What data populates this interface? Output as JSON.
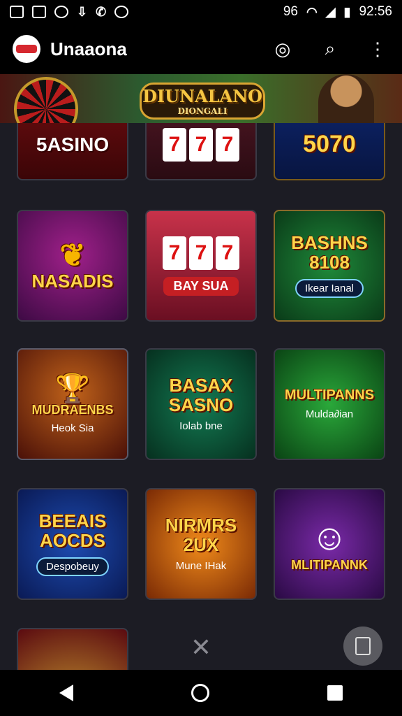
{
  "status": {
    "time": "92:56",
    "network_label": "96",
    "left_icons": [
      "gallery-icon",
      "image-icon",
      "sync-icon",
      "download-icon",
      "call-icon",
      "circle-icon"
    ],
    "right_icons": [
      "wifi-icon",
      "signal-icon",
      "battery-icon"
    ]
  },
  "appbar": {
    "title": "Unaaona",
    "actions": [
      "qr-icon",
      "search-icon",
      "more-vert-icon"
    ]
  },
  "banner": {
    "title": "DIUNALANO",
    "subtitle": "DIONGALI"
  },
  "tiles": [
    {
      "name": "tile-5asino",
      "title": "5ASINO",
      "caption": ""
    },
    {
      "name": "tile-slots-reels",
      "title": "",
      "caption": ""
    },
    {
      "name": "tile-5070",
      "title": "5070",
      "caption": ""
    },
    {
      "name": "tile-nasadis",
      "title": "NASADIS",
      "caption": ""
    },
    {
      "name": "tile-bay-sua",
      "title": "",
      "caption": "BAY SUA"
    },
    {
      "name": "tile-basans-8108",
      "title": "BASHNS 8108",
      "caption": "Ikear Ianal"
    },
    {
      "name": "tile-mudraenbs",
      "title": "MUDRAENBS",
      "caption": "Heok Sia"
    },
    {
      "name": "tile-basax-sasno",
      "title": "BASAX SASNO",
      "caption": "Iolab bne"
    },
    {
      "name": "tile-multipanns",
      "title": "MULTIPANNS",
      "caption": "Mulda∂ian"
    },
    {
      "name": "tile-beeais-aocds",
      "title": "BEEAIS AOCDS",
      "caption": "Despobeuy"
    },
    {
      "name": "tile-nirmrs-2ux",
      "title": "NIRMRS 2UX",
      "caption": "Mune IHak"
    },
    {
      "name": "tile-multipannk",
      "title": "MLITIPANNK",
      "caption": ""
    },
    {
      "name": "tile-partial",
      "title": "",
      "caption": ""
    }
  ],
  "reels": [
    "7",
    "7",
    "7"
  ],
  "colors": {
    "background": "#1c1c24",
    "accent": "#ffd54a",
    "red": "#c51f23"
  }
}
